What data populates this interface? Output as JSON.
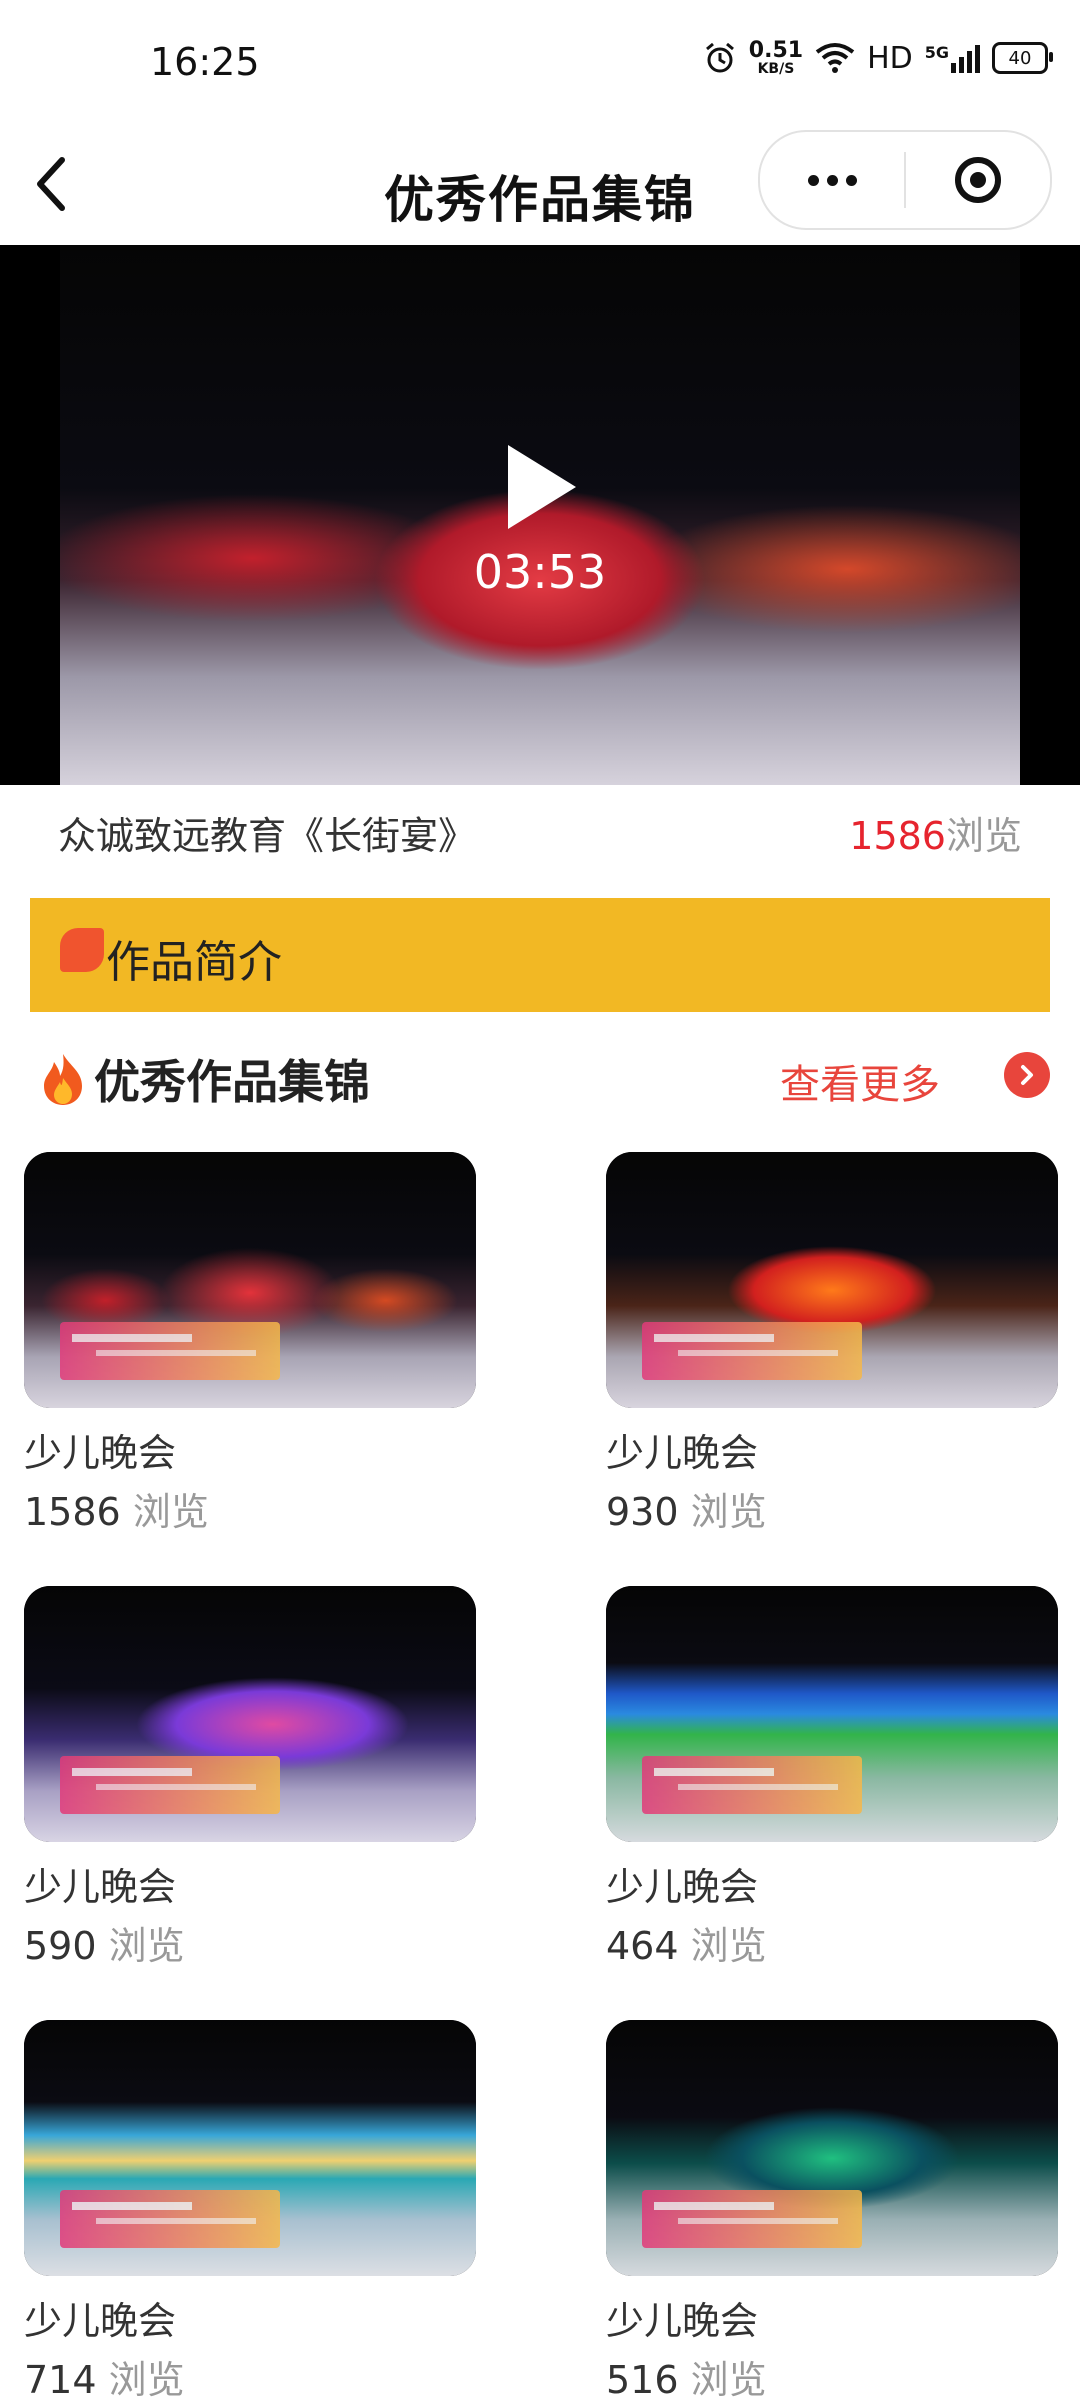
{
  "status_bar": {
    "time": "16:25",
    "net_speed": "0.51",
    "net_unit": "KB/S",
    "hd": "HD",
    "signal": "5G",
    "battery": "40"
  },
  "nav": {
    "title": "优秀作品集锦"
  },
  "video": {
    "duration": "03:53",
    "title": "众诚致远教育《长街宴》",
    "views_count": "1586",
    "views_unit": "浏览"
  },
  "intro": {
    "label": "作品简介"
  },
  "section": {
    "title": "优秀作品集锦",
    "more": "查看更多"
  },
  "works": [
    {
      "title": "少儿晚会",
      "views": "1586",
      "unit": "浏览"
    },
    {
      "title": "少儿晚会",
      "views": "930",
      "unit": "浏览"
    },
    {
      "title": "少儿晚会",
      "views": "590",
      "unit": "浏览"
    },
    {
      "title": "少儿晚会",
      "views": "464",
      "unit": "浏览"
    },
    {
      "title": "少儿晚会",
      "views": "714",
      "unit": "浏览"
    },
    {
      "title": "少儿晚会",
      "views": "516",
      "unit": "浏览"
    }
  ],
  "colors": {
    "accent": "#e8453c",
    "intro_bg": "#f2b824",
    "views_red": "#e6242e"
  },
  "icons": [
    "back-arrow-icon",
    "more-dots-icon",
    "target-icon",
    "play-icon",
    "fire-icon",
    "chevron-right-icon",
    "alarm-icon",
    "wifi-icon",
    "signal-icon",
    "battery-icon"
  ]
}
